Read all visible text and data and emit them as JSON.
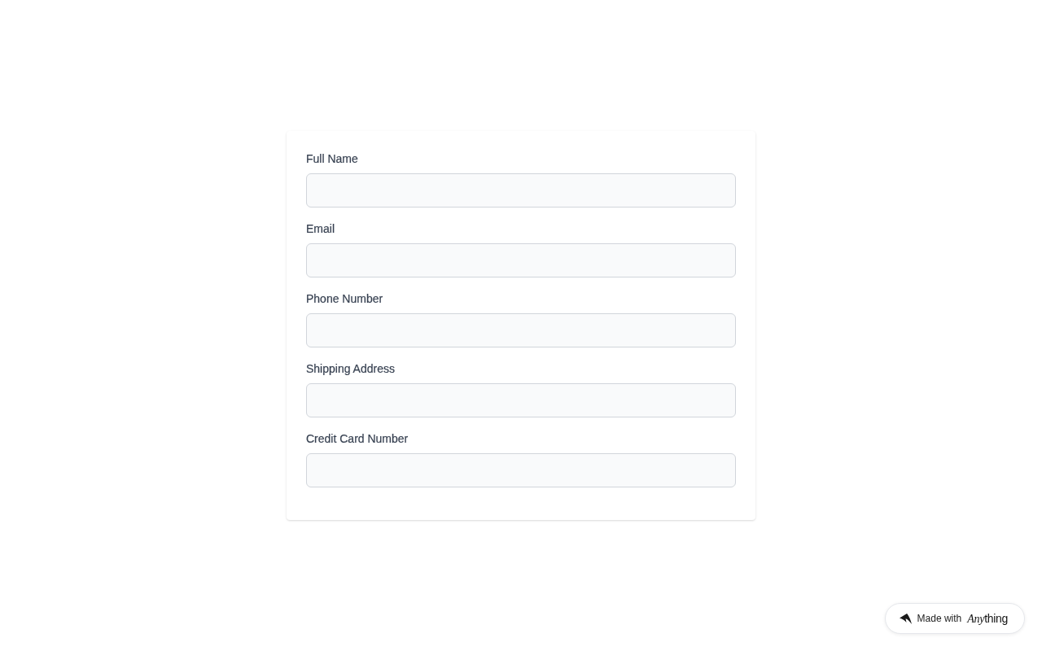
{
  "form": {
    "fields": [
      {
        "label": "Full Name"
      },
      {
        "label": "Email"
      },
      {
        "label": "Phone Number"
      },
      {
        "label": "Shipping Address"
      },
      {
        "label": "Credit Card Number"
      }
    ]
  },
  "badge": {
    "text": "Made with",
    "brand": {
      "italic_part": "Any",
      "rest": "thing"
    }
  }
}
